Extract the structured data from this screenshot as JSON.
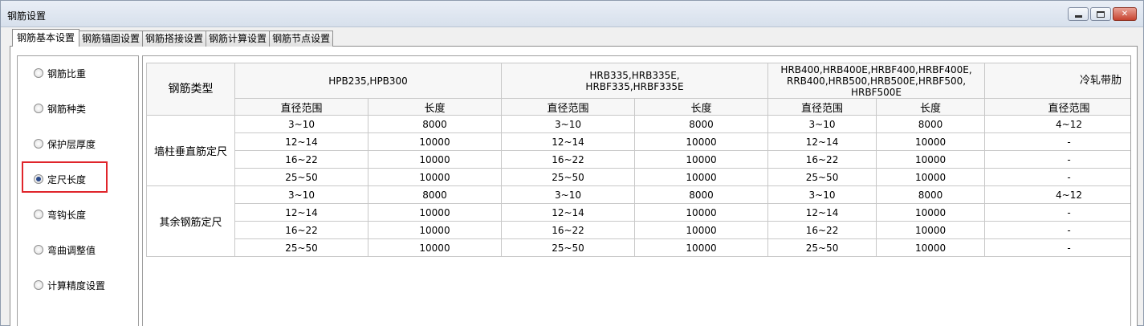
{
  "window": {
    "title": "钢筋设置"
  },
  "tabs": [
    "钢筋基本设置",
    "钢筋锚固设置",
    "钢筋搭接设置",
    "钢筋计算设置",
    "钢筋节点设置"
  ],
  "left_options": [
    {
      "label": "钢筋比重",
      "checked": false
    },
    {
      "label": "钢筋种类",
      "checked": false
    },
    {
      "label": "保护层厚度",
      "checked": false
    },
    {
      "label": "定尺长度",
      "checked": true
    },
    {
      "label": "弯钩长度",
      "checked": false
    },
    {
      "label": "弯曲调整值",
      "checked": false
    },
    {
      "label": "计算精度设置",
      "checked": false
    }
  ],
  "table": {
    "type_header": "钢筋类型",
    "groups": [
      "HPB235,HPB300",
      "HRB335,HRB335E,\nHRBF335,HRBF335E",
      "HRB400,HRB400E,HRBF400,HRBF400E,\nRRB400,HRB500,HRB500E,HRBF500,\nHRBF500E",
      "冷轧带肋"
    ],
    "sub_headers": [
      "直径范围",
      "长度",
      "直径范围",
      "长度",
      "直径范围",
      "长度",
      "直径范围"
    ],
    "row_groups": [
      {
        "name": "墙柱垂直筋定尺",
        "rows": [
          [
            "3~10",
            "8000",
            "3~10",
            "8000",
            "3~10",
            "8000",
            "4~12"
          ],
          [
            "12~14",
            "10000",
            "12~14",
            "10000",
            "12~14",
            "10000",
            "-"
          ],
          [
            "16~22",
            "10000",
            "16~22",
            "10000",
            "16~22",
            "10000",
            "-"
          ],
          [
            "25~50",
            "10000",
            "25~50",
            "10000",
            "25~50",
            "10000",
            "-"
          ]
        ]
      },
      {
        "name": "其余钢筋定尺",
        "rows": [
          [
            "3~10",
            "8000",
            "3~10",
            "8000",
            "3~10",
            "8000",
            "4~12"
          ],
          [
            "12~14",
            "10000",
            "12~14",
            "10000",
            "12~14",
            "10000",
            "-"
          ],
          [
            "16~22",
            "10000",
            "16~22",
            "10000",
            "16~22",
            "10000",
            "-"
          ],
          [
            "25~50",
            "10000",
            "25~50",
            "10000",
            "25~50",
            "10000",
            "-"
          ]
        ]
      }
    ]
  }
}
